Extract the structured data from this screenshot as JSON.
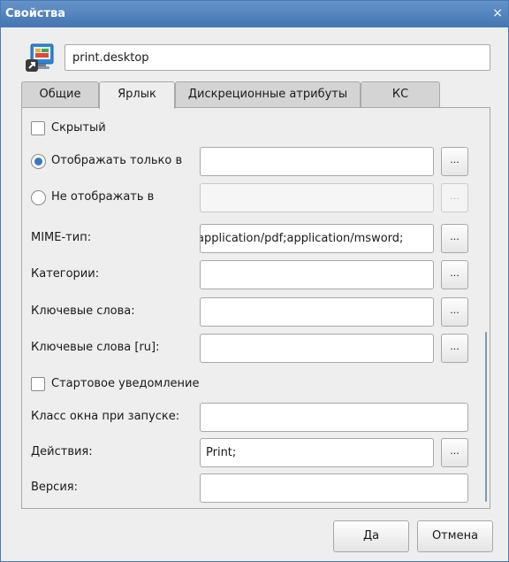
{
  "window": {
    "title": "Свойства",
    "close_glyph": "×"
  },
  "file": {
    "name": "print.desktop",
    "icon": "desktop-file-icon"
  },
  "tabs": [
    {
      "label": "Общие"
    },
    {
      "label": "Ярлык"
    },
    {
      "label": "Дискреционные атрибуты"
    },
    {
      "label": "КС"
    }
  ],
  "active_tab": "Ярлык",
  "shortcut": {
    "hidden": {
      "label": "Скрытый",
      "checked": false
    },
    "show_only_in": {
      "label": "Отображать только в",
      "selected": true,
      "value": ""
    },
    "not_show_in": {
      "label": "Не отображать в",
      "selected": false,
      "value": ""
    },
    "mime": {
      "label": "MIME-тип:",
      "value": "application/pdf;application/msword;"
    },
    "categories": {
      "label": "Категории:",
      "value": ""
    },
    "keywords": {
      "label": "Ключевые слова:",
      "value": ""
    },
    "keywords_ru": {
      "label": "Ключевые слова [ru]:",
      "value": ""
    },
    "startup_notify": {
      "label": "Стартовое уведомление",
      "checked": false
    },
    "wm_class": {
      "label": "Класс окна при запуске:",
      "value": ""
    },
    "actions": {
      "label": "Действия:",
      "value": "Print;"
    },
    "version": {
      "label": "Версия:",
      "value": ""
    },
    "browse_label": "..."
  },
  "buttons": {
    "ok": "Да",
    "cancel": "Отмена"
  },
  "colors": {
    "titlebar": "#4f80bb",
    "radio_accent": "#3a78c4",
    "background": "#eeeeee"
  }
}
